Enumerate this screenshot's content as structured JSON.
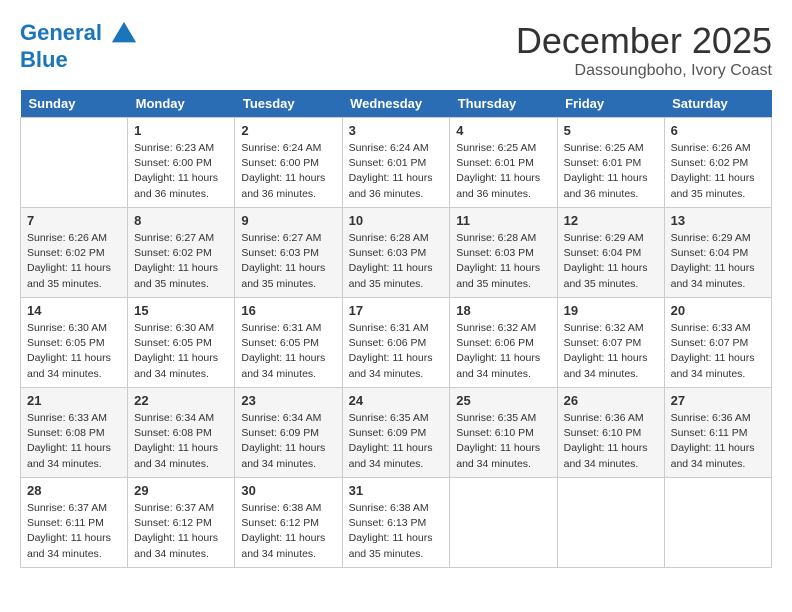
{
  "header": {
    "logo_line1": "General",
    "logo_line2": "Blue",
    "month": "December 2025",
    "location": "Dassoungboho, Ivory Coast"
  },
  "days_of_week": [
    "Sunday",
    "Monday",
    "Tuesday",
    "Wednesday",
    "Thursday",
    "Friday",
    "Saturday"
  ],
  "weeks": [
    [
      {
        "day": "",
        "info": ""
      },
      {
        "day": "1",
        "info": "Sunrise: 6:23 AM\nSunset: 6:00 PM\nDaylight: 11 hours and 36 minutes."
      },
      {
        "day": "2",
        "info": "Sunrise: 6:24 AM\nSunset: 6:00 PM\nDaylight: 11 hours and 36 minutes."
      },
      {
        "day": "3",
        "info": "Sunrise: 6:24 AM\nSunset: 6:01 PM\nDaylight: 11 hours and 36 minutes."
      },
      {
        "day": "4",
        "info": "Sunrise: 6:25 AM\nSunset: 6:01 PM\nDaylight: 11 hours and 36 minutes."
      },
      {
        "day": "5",
        "info": "Sunrise: 6:25 AM\nSunset: 6:01 PM\nDaylight: 11 hours and 36 minutes."
      },
      {
        "day": "6",
        "info": "Sunrise: 6:26 AM\nSunset: 6:02 PM\nDaylight: 11 hours and 35 minutes."
      }
    ],
    [
      {
        "day": "7",
        "info": "Sunrise: 6:26 AM\nSunset: 6:02 PM\nDaylight: 11 hours and 35 minutes."
      },
      {
        "day": "8",
        "info": "Sunrise: 6:27 AM\nSunset: 6:02 PM\nDaylight: 11 hours and 35 minutes."
      },
      {
        "day": "9",
        "info": "Sunrise: 6:27 AM\nSunset: 6:03 PM\nDaylight: 11 hours and 35 minutes."
      },
      {
        "day": "10",
        "info": "Sunrise: 6:28 AM\nSunset: 6:03 PM\nDaylight: 11 hours and 35 minutes."
      },
      {
        "day": "11",
        "info": "Sunrise: 6:28 AM\nSunset: 6:03 PM\nDaylight: 11 hours and 35 minutes."
      },
      {
        "day": "12",
        "info": "Sunrise: 6:29 AM\nSunset: 6:04 PM\nDaylight: 11 hours and 35 minutes."
      },
      {
        "day": "13",
        "info": "Sunrise: 6:29 AM\nSunset: 6:04 PM\nDaylight: 11 hours and 34 minutes."
      }
    ],
    [
      {
        "day": "14",
        "info": "Sunrise: 6:30 AM\nSunset: 6:05 PM\nDaylight: 11 hours and 34 minutes."
      },
      {
        "day": "15",
        "info": "Sunrise: 6:30 AM\nSunset: 6:05 PM\nDaylight: 11 hours and 34 minutes."
      },
      {
        "day": "16",
        "info": "Sunrise: 6:31 AM\nSunset: 6:05 PM\nDaylight: 11 hours and 34 minutes."
      },
      {
        "day": "17",
        "info": "Sunrise: 6:31 AM\nSunset: 6:06 PM\nDaylight: 11 hours and 34 minutes."
      },
      {
        "day": "18",
        "info": "Sunrise: 6:32 AM\nSunset: 6:06 PM\nDaylight: 11 hours and 34 minutes."
      },
      {
        "day": "19",
        "info": "Sunrise: 6:32 AM\nSunset: 6:07 PM\nDaylight: 11 hours and 34 minutes."
      },
      {
        "day": "20",
        "info": "Sunrise: 6:33 AM\nSunset: 6:07 PM\nDaylight: 11 hours and 34 minutes."
      }
    ],
    [
      {
        "day": "21",
        "info": "Sunrise: 6:33 AM\nSunset: 6:08 PM\nDaylight: 11 hours and 34 minutes."
      },
      {
        "day": "22",
        "info": "Sunrise: 6:34 AM\nSunset: 6:08 PM\nDaylight: 11 hours and 34 minutes."
      },
      {
        "day": "23",
        "info": "Sunrise: 6:34 AM\nSunset: 6:09 PM\nDaylight: 11 hours and 34 minutes."
      },
      {
        "day": "24",
        "info": "Sunrise: 6:35 AM\nSunset: 6:09 PM\nDaylight: 11 hours and 34 minutes."
      },
      {
        "day": "25",
        "info": "Sunrise: 6:35 AM\nSunset: 6:10 PM\nDaylight: 11 hours and 34 minutes."
      },
      {
        "day": "26",
        "info": "Sunrise: 6:36 AM\nSunset: 6:10 PM\nDaylight: 11 hours and 34 minutes."
      },
      {
        "day": "27",
        "info": "Sunrise: 6:36 AM\nSunset: 6:11 PM\nDaylight: 11 hours and 34 minutes."
      }
    ],
    [
      {
        "day": "28",
        "info": "Sunrise: 6:37 AM\nSunset: 6:11 PM\nDaylight: 11 hours and 34 minutes."
      },
      {
        "day": "29",
        "info": "Sunrise: 6:37 AM\nSunset: 6:12 PM\nDaylight: 11 hours and 34 minutes."
      },
      {
        "day": "30",
        "info": "Sunrise: 6:38 AM\nSunset: 6:12 PM\nDaylight: 11 hours and 34 minutes."
      },
      {
        "day": "31",
        "info": "Sunrise: 6:38 AM\nSunset: 6:13 PM\nDaylight: 11 hours and 35 minutes."
      },
      {
        "day": "",
        "info": ""
      },
      {
        "day": "",
        "info": ""
      },
      {
        "day": "",
        "info": ""
      }
    ]
  ]
}
